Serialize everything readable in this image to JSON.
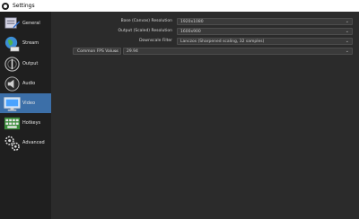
{
  "window": {
    "title": "Settings"
  },
  "sidebar": {
    "items": [
      {
        "label": "General",
        "icon": "general-icon",
        "active": false
      },
      {
        "label": "Stream",
        "icon": "globe-icon",
        "active": false
      },
      {
        "label": "Output",
        "icon": "output-icon",
        "active": false
      },
      {
        "label": "Audio",
        "icon": "speaker-icon",
        "active": false
      },
      {
        "label": "Video",
        "icon": "monitor-icon",
        "active": true
      },
      {
        "label": "Hotkeys",
        "icon": "keyboard-icon",
        "active": false
      },
      {
        "label": "Advanced",
        "icon": "gears-icon",
        "active": false
      }
    ]
  },
  "video": {
    "base_resolution": {
      "label": "Base (Canvas) Resolution",
      "value": "1920x1080"
    },
    "output_resolution": {
      "label": "Output (Scaled) Resolution",
      "value": "1600x900"
    },
    "downscale_filter": {
      "label": "Downscale Filter",
      "value": "Lanczos (Sharpened scaling, 32 samples)"
    },
    "fps": {
      "label": "Common FPS Values",
      "value": "29.94"
    }
  },
  "colors": {
    "accent": "#3c6fa8",
    "sidebar": "#1f1f1f",
    "panel": "#2b2b2b"
  }
}
